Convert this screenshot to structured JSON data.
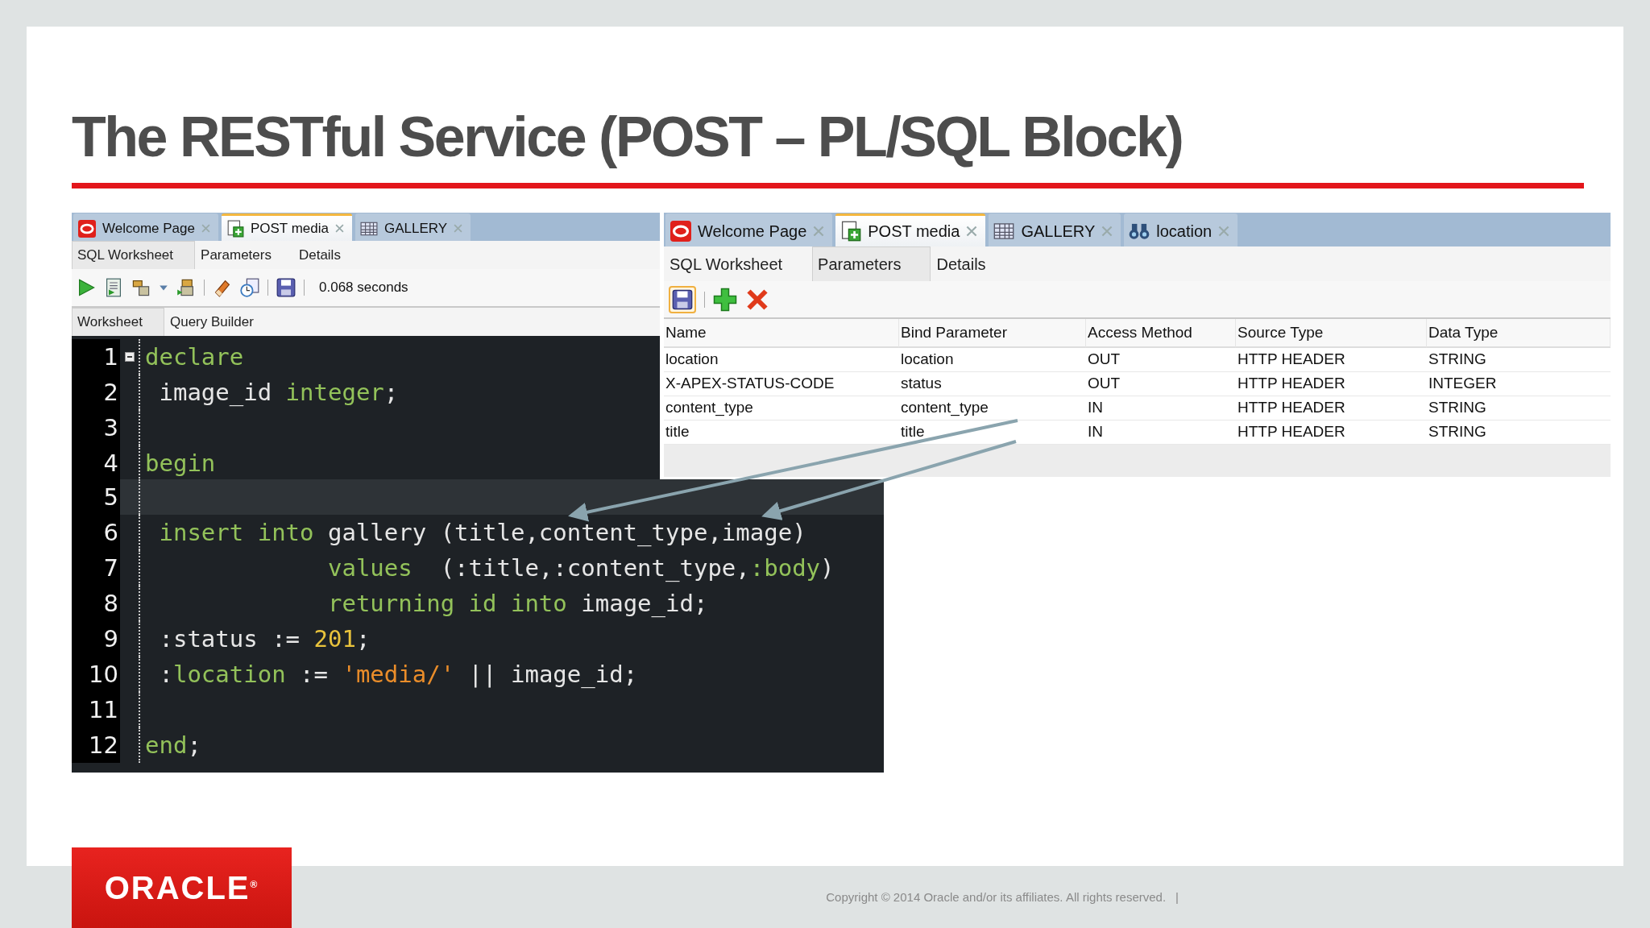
{
  "slide": {
    "title": "The RESTful Service (POST – PL/SQL Block)",
    "logo": "ORACLE$^{®}$",
    "footer": "Copyright © 2014 Oracle and/or its affiliates. All rights reserved.",
    "footer_separator": "|"
  },
  "left_window": {
    "doc_tabs": [
      {
        "label": "Welcome Page",
        "kind": "ring",
        "selected": false
      },
      {
        "label": "POST media",
        "kind": "document",
        "selected": true
      },
      {
        "label": "GALLERY",
        "kind": "grid",
        "selected": false
      }
    ],
    "sub_tabs": [
      {
        "label": "SQL Worksheet",
        "selected": true
      },
      {
        "label": "Parameters",
        "selected": false
      },
      {
        "label": "Details",
        "selected": false
      }
    ],
    "toolbar_status": "0.068 seconds",
    "editor_tabs": [
      {
        "label": "Worksheet",
        "selected": true
      },
      {
        "label": "Query Builder",
        "selected": false
      }
    ],
    "code_lines": [
      {
        "number": "1",
        "current": false,
        "tokens": [
          {
            "kind": "keyword",
            "text": "declare"
          }
        ]
      },
      {
        "number": "2",
        "current": false,
        "tokens": [
          {
            "kind": "plain",
            "text": " image_id "
          },
          {
            "kind": "keyword",
            "text": "integer"
          },
          {
            "kind": "plain",
            "text": ";"
          }
        ]
      },
      {
        "number": "3",
        "current": false
      },
      {
        "number": "4",
        "current": false,
        "tokens": [
          {
            "kind": "keyword",
            "text": "begin"
          }
        ]
      },
      {
        "number": "5",
        "current": true
      },
      {
        "number": "6",
        "current": false,
        "tokens": [
          {
            "kind": "keyword",
            "text": " insert into"
          },
          {
            "kind": "plain",
            "text": " gallery (title,content_type,image)"
          }
        ]
      },
      {
        "number": "7",
        "current": false,
        "tokens": [
          {
            "kind": "keyword",
            "text": "             values"
          },
          {
            "kind": "plain",
            "text": "  (:title,:content_type,"
          },
          {
            "kind": "keyword",
            "text": ":body"
          },
          {
            "kind": "plain",
            "text": ")"
          }
        ]
      },
      {
        "number": "8",
        "current": false,
        "tokens": [
          {
            "kind": "keyword",
            "text": "             returning id into"
          },
          {
            "kind": "plain",
            "text": " image_id;"
          }
        ]
      },
      {
        "number": "9",
        "current": false,
        "tokens": [
          {
            "kind": "plain",
            "text": " :status := "
          },
          {
            "kind": "number",
            "text": "201"
          },
          {
            "kind": "plain",
            "text": ";"
          }
        ]
      },
      {
        "number": "10",
        "current": false,
        "tokens": [
          {
            "kind": "plain",
            "text": " :"
          },
          {
            "kind": "keyword",
            "text": "location"
          },
          {
            "kind": "plain",
            "text": " := "
          },
          {
            "kind": "string",
            "text": "'media/'"
          },
          {
            "kind": "plain",
            "text": " || image_id;"
          }
        ]
      },
      {
        "number": "11",
        "current": false
      },
      {
        "number": "12",
        "current": false,
        "tokens": [
          {
            "kind": "keyword",
            "text": "end"
          },
          {
            "kind": "plain",
            "text": ";"
          }
        ]
      }
    ]
  },
  "right_window": {
    "doc_tabs": [
      {
        "label": "Welcome Page",
        "kind": "ring",
        "selected": false
      },
      {
        "label": "POST media",
        "kind": "document",
        "selected": true
      },
      {
        "label": "GALLERY",
        "kind": "grid",
        "selected": false
      },
      {
        "label": "location",
        "kind": "binoculars",
        "selected": false
      }
    ],
    "sub_tabs": [
      {
        "label": "SQL Worksheet",
        "selected": false
      },
      {
        "label": "Parameters",
        "selected": true
      },
      {
        "label": "Details",
        "selected": false
      }
    ],
    "table": {
      "columns": [
        "Name",
        "Bind Parameter",
        "Access Method",
        "Source Type",
        "Data Type"
      ],
      "rows": [
        [
          "location",
          "location",
          "OUT",
          "HTTP HEADER",
          "STRING"
        ],
        [
          "X-APEX-STATUS-CODE",
          "status",
          "OUT",
          "HTTP HEADER",
          "INTEGER"
        ],
        [
          "content_type",
          "content_type",
          "IN",
          "HTTP HEADER",
          "STRING"
        ],
        [
          "title",
          "title",
          "IN",
          "HTTP HEADER",
          "STRING"
        ]
      ]
    }
  }
}
